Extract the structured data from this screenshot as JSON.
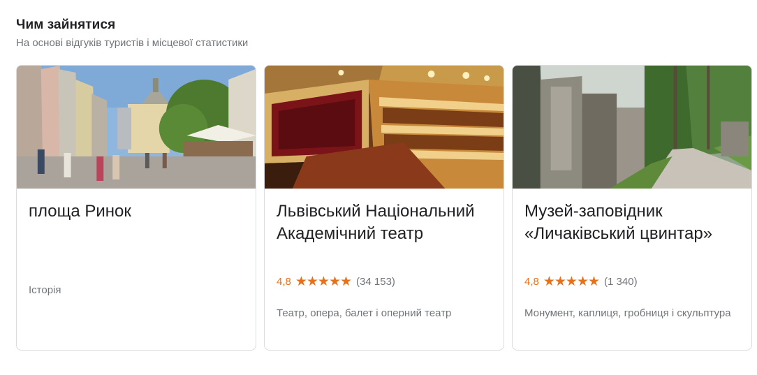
{
  "header": {
    "title": "Чим зайнятися",
    "subtitle": "На основі відгуків туристів і місцевої статистики"
  },
  "cards": [
    {
      "title": "площа Ринок",
      "category": "Історія",
      "image_icon": "city-square-photo"
    },
    {
      "title": "Львівський Національний Академічний театр",
      "rating": "4,8",
      "stars": "★★★★★",
      "star_value": 4.8,
      "reviews": "(34 153)",
      "category": "Театр, опера, балет і оперний театр",
      "image_icon": "theatre-hall-photo"
    },
    {
      "title": "Музей-заповідник «Личаківський цвинтар»",
      "rating": "4,8",
      "stars": "★★★★★",
      "star_value": 4.8,
      "reviews": "(1 340)",
      "category": "Монумент, каплиця, гробниця і скульптура",
      "image_icon": "cemetery-photo"
    }
  ],
  "colors": {
    "rating": "#e7711b",
    "secondary_text": "#70757a",
    "border": "#dadce0"
  }
}
